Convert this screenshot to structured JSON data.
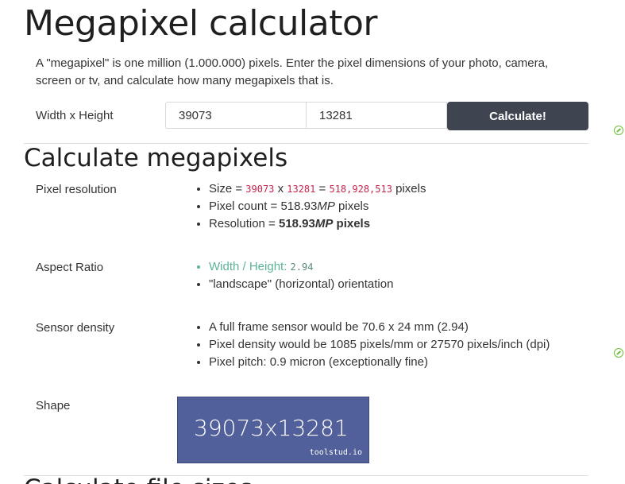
{
  "page": {
    "title": "Megapixel calculator",
    "intro": "A \"megapixel\" is one million (1.000.000) pixels. Enter the pixel dimensions of your photo, camera, screen or tv, and calculate how many megapixels that is."
  },
  "form": {
    "label": "Width x Height",
    "width_value": "39073",
    "height_value": "13281",
    "button_label": "Calculate!"
  },
  "results": {
    "section_title": "Calculate megapixels",
    "pixel_resolution": {
      "label": "Pixel resolution",
      "size_prefix": "Size = ",
      "size_width": "39073",
      "size_times": " x ",
      "size_height": "13281",
      "size_equals": " = ",
      "size_total": "518,928,513",
      "size_suffix": " pixels",
      "count_prefix": "Pixel count = 518.93",
      "count_unit": "MP",
      "count_suffix": " pixels",
      "resolution_prefix": "Resolution = ",
      "resolution_value": "518.93",
      "resolution_unit": "MP",
      "resolution_suffix": " pixels"
    },
    "aspect_ratio": {
      "label": "Aspect Ratio",
      "ratio_label": "Width / Height: ",
      "ratio_value": "2.94",
      "orientation": "\"landscape\" (horizontal) orientation"
    },
    "sensor_density": {
      "label": "Sensor density",
      "full_frame": "A full frame sensor would be 70.6 x 24 mm (2.94)",
      "pixel_density": "Pixel density would be 1085 pixels/mm or 27570 pixels/inch (dpi)",
      "pixel_pitch": "Pixel pitch: 0.9 micron (exceptionally fine)"
    },
    "shape": {
      "label": "Shape",
      "dimensions": "39073x13281",
      "watermark": "toolstud.io"
    }
  },
  "next_section": {
    "title": "Calculate file sizes"
  },
  "colors": {
    "button": "#3e4450",
    "code": "#c7254e",
    "teal": "#5cb39a",
    "shape_fill": "#515f9a",
    "side_icon": "#6cbf3a"
  },
  "icons": [
    "side-indicator-icon"
  ]
}
